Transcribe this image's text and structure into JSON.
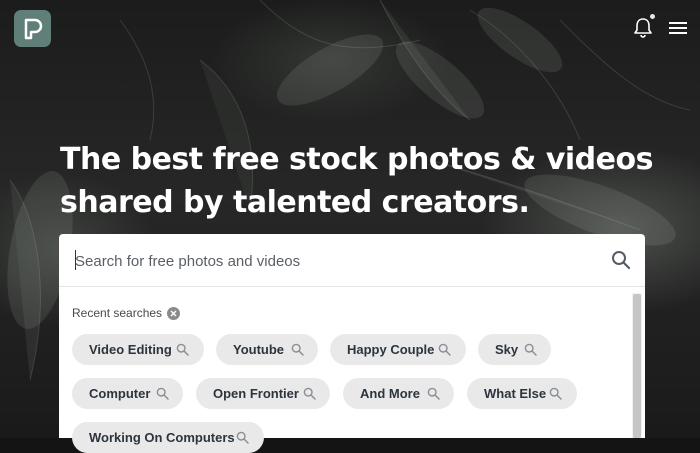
{
  "brand": {
    "logo_letter": "P",
    "accent_color": "#5f7f78"
  },
  "hero": {
    "headline_line1": "The best free stock photos & videos",
    "headline_line2": "shared by talented creators."
  },
  "header": {
    "icons": [
      "bell-icon",
      "hamburger-menu-icon"
    ]
  },
  "search": {
    "placeholder": "Search for free photos and videos",
    "value": ""
  },
  "recent": {
    "label": "Recent searches",
    "chips": [
      {
        "label": "Video Editing"
      },
      {
        "label": "Youtube"
      },
      {
        "label": "Happy Couple"
      },
      {
        "label": "Sky"
      },
      {
        "label": "Computer"
      },
      {
        "label": "Open Frontier"
      },
      {
        "label": "And More"
      },
      {
        "label": "What Else"
      },
      {
        "label": "Working On Computers"
      }
    ]
  }
}
